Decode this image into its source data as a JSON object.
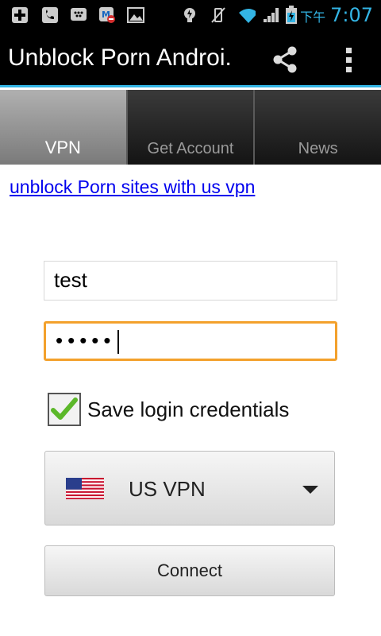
{
  "status_bar": {
    "time_prefix": "下午",
    "time": "7:07",
    "icons": [
      "plus-icon",
      "missed-call-icon",
      "bbm-icon",
      "app-blocked-icon",
      "image-icon",
      "bulb-icon",
      "vibrate-off-icon",
      "wifi-icon",
      "signal-icon",
      "battery-charging-icon"
    ],
    "accent_color": "#33b5e5"
  },
  "action_bar": {
    "title": "Unblock Porn Androi.",
    "actions": [
      "share-icon",
      "overflow-menu-icon"
    ]
  },
  "tabs": [
    {
      "label": "VPN",
      "selected": true
    },
    {
      "label": "Get Account",
      "selected": false
    },
    {
      "label": "News",
      "selected": false
    }
  ],
  "promo_link": "unblock Porn sites with us vpn",
  "form": {
    "username_value": "test",
    "password_value": "•••••",
    "save_credentials_label": "Save login credentials",
    "save_credentials_checked": true,
    "server_selected": "US VPN",
    "server_flag": "us-flag-icon",
    "connect_label": "Connect",
    "focus_color": "#f3a12c"
  }
}
